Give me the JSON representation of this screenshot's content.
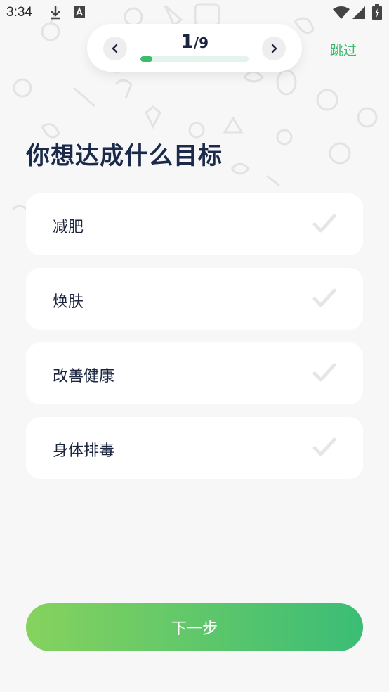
{
  "status_bar": {
    "time": "3:34",
    "icons": [
      "download-icon",
      "text-a-icon",
      "wifi-icon",
      "signal-icon",
      "battery-icon"
    ]
  },
  "progress": {
    "current": "1",
    "separator": "/",
    "total": "9",
    "fraction": 0.11,
    "accent_color": "#3cba6e"
  },
  "header": {
    "skip_label": "跳过"
  },
  "main": {
    "title": "你想达成什么目标",
    "options": [
      {
        "label": "减肥",
        "checked": false
      },
      {
        "label": "焕肤",
        "checked": false
      },
      {
        "label": "改善健康",
        "checked": false
      },
      {
        "label": "身体排毒",
        "checked": false
      }
    ]
  },
  "footer": {
    "next_label": "下一步",
    "gradient_start": "#86d25e",
    "gradient_end": "#3bbd76"
  }
}
